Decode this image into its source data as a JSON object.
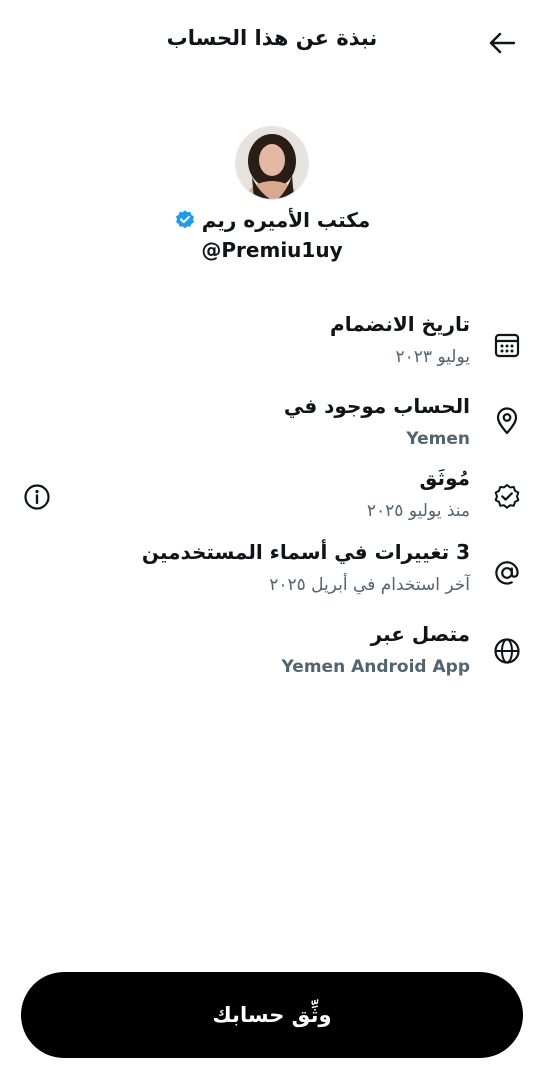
{
  "header": {
    "title": "نبذة عن هذا الحساب",
    "back_icon": "arrow-left-icon"
  },
  "profile": {
    "name": "مكتب الأميره ريم",
    "handle": "@Premiu1uy",
    "verified_color": "#1d9bf0"
  },
  "details": {
    "joined": {
      "title": "تاريخ الانضمام",
      "value": "يوليو ٢٠٢٣",
      "icon": "calendar-icon"
    },
    "location": {
      "title": "الحساب موجود في",
      "value": "Yemen",
      "icon": "location-pin-icon"
    },
    "verified": {
      "title": "مُوثَق",
      "value": "منذ يوليو ٢٠٢٥",
      "icon": "verified-badge-icon"
    },
    "username_changes": {
      "title": "3 تغييرات في أسماء المستخدمين",
      "value": "آخر استخدام في أبريل ٢٠٢٥",
      "icon": "at-sign-icon"
    },
    "connected_via": {
      "title": "متصل عبر",
      "value": "Yemen Android App",
      "icon": "globe-icon"
    }
  },
  "info_icon": "info-icon",
  "cta": {
    "label": "وثِّق حسابك"
  }
}
